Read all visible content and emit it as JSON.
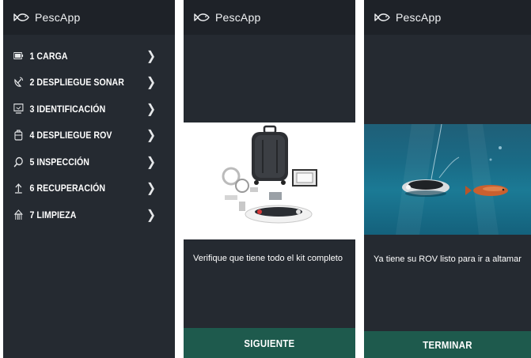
{
  "app": {
    "title": "PescApp",
    "logo_icon": "fish-icon"
  },
  "menu": {
    "items": [
      {
        "label": "1 CARGA",
        "icon": "battery-icon"
      },
      {
        "label": "2 DESPLIEGUE SONAR",
        "icon": "satellite-dish-icon"
      },
      {
        "label": "3 IDENTIFICACIÓN",
        "icon": "monitor-icon"
      },
      {
        "label": "4 DESPLIEGUE ROV",
        "icon": "case-icon"
      },
      {
        "label": "5 INSPECCIÓN",
        "icon": "search-icon"
      },
      {
        "label": "6 RECUPERACIÓN",
        "icon": "arrow-up-icon"
      },
      {
        "label": "7 LIMPIEZA",
        "icon": "cleaning-icon"
      }
    ]
  },
  "step_kit": {
    "caption": "Verifique que tiene todo el kit completo",
    "button": "SIGUIENTE"
  },
  "step_ready": {
    "caption": "Ya tiene su ROV listo para ir a altamar",
    "button": "TERMINAR"
  },
  "colors": {
    "background": "#252a31",
    "appbar": "#1e2228",
    "action": "#1e5a4d"
  }
}
